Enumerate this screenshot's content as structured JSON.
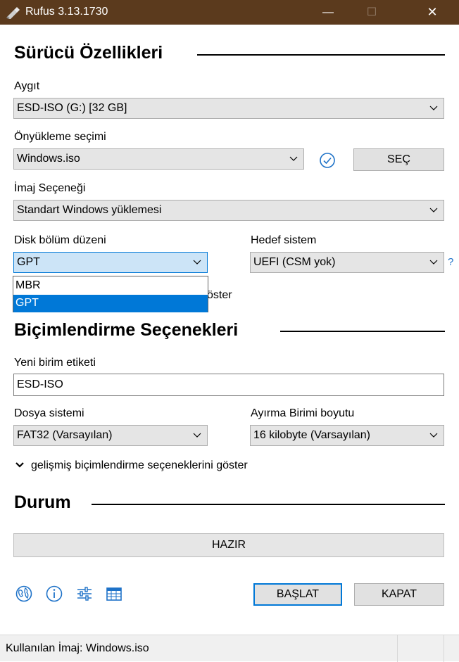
{
  "window": {
    "title": "Rufus 3.13.1730",
    "minimize_glyph": "—",
    "maximize_glyph": "☐",
    "close_glyph": "✕"
  },
  "drive_props": {
    "heading": "Sürücü Özellikleri",
    "device_label": "Aygıt",
    "device_value": "ESD-ISO (G:) [32 GB]",
    "boot_label": "Önyükleme seçimi",
    "boot_value": "Windows.iso",
    "select_button": "SEÇ",
    "image_option_label": "İmaj Seçeneği",
    "image_option_value": "Standart Windows yüklemesi",
    "partition_label": "Disk bölüm düzeni",
    "partition_value": "GPT",
    "partition_options": [
      "MBR",
      "GPT"
    ],
    "partition_selected_index": 1,
    "target_label": "Hedef sistem",
    "target_value": "UEFI (CSM yok)",
    "help_glyph": "?",
    "hidden_toggle_fragment": "öster"
  },
  "format_opts": {
    "heading": "Biçimlendirme Seçenekleri",
    "volume_label": "Yeni birim etiketi",
    "volume_value": "ESD-ISO",
    "fs_label": "Dosya sistemi",
    "fs_value": "FAT32 (Varsayılan)",
    "cluster_label": "Ayırma Birimi boyutu",
    "cluster_value": "16 kilobyte (Varsayılan)",
    "advanced_toggle": "gelişmiş biçimlendirme seçeneklerini göster"
  },
  "status": {
    "heading": "Durum",
    "progress_text": "HAZIR",
    "start_button": "BAŞLAT",
    "close_button": "KAPAT"
  },
  "statusbar": {
    "text": "Kullanılan İmaj: Windows.iso"
  },
  "colors": {
    "titlebar": "#5b3a1d",
    "accent": "#0078d7",
    "icon_blue": "#1e72c8"
  },
  "icons": [
    "globe-icon",
    "info-icon",
    "settings-sliders-icon",
    "log-icon",
    "check-circle-icon"
  ]
}
